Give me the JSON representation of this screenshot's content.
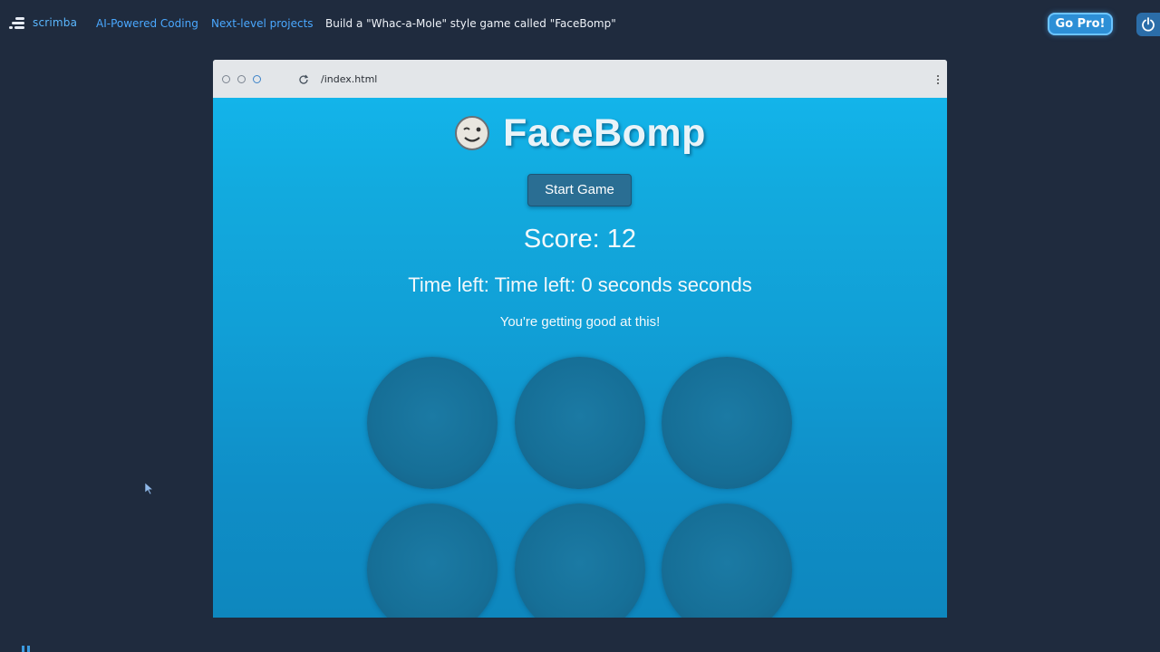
{
  "nav": {
    "logo_text": "scrimba",
    "breadcrumbs": [
      "AI-Powered Coding",
      "Next-level projects"
    ],
    "current": "Build a \"Whac-a-Mole\" style game called \"FaceBomp\"",
    "pro_button": "Go Pro!"
  },
  "browser": {
    "url": "/index.html"
  },
  "game": {
    "title": "FaceBomp",
    "start_button": "Start Game",
    "score_text": "Score: 12",
    "time_text": "Time left: Time left: 0 seconds seconds",
    "message": "You're getting good at this!",
    "holes_count": 6
  },
  "colors": {
    "page_bg": "#1f2b3e",
    "accent": "#4aa8ff",
    "game_bg": "#12aade",
    "hole": "#166f97"
  }
}
